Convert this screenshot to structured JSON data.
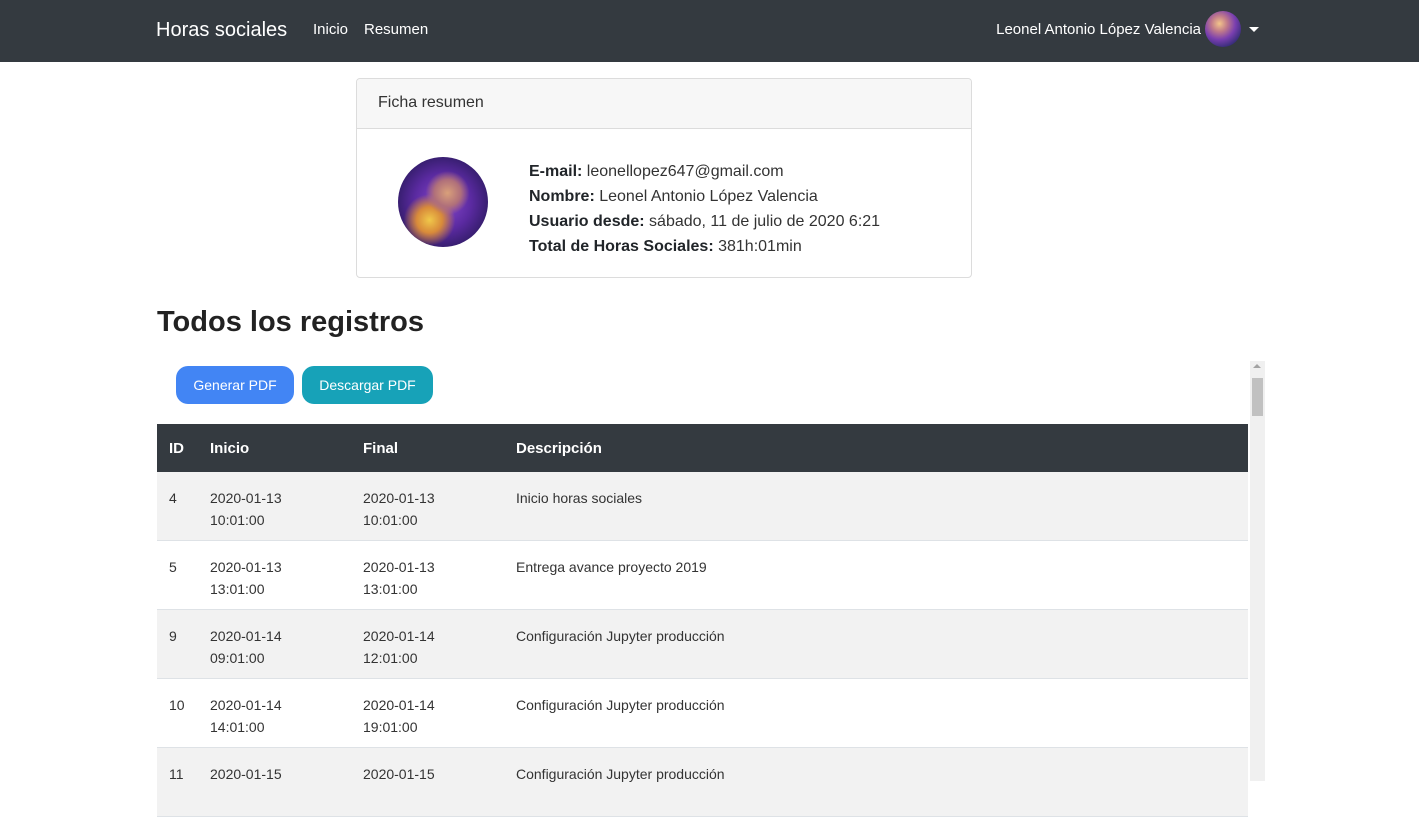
{
  "navbar": {
    "brand": "Horas sociales",
    "links": [
      "Inicio",
      "Resumen"
    ],
    "user_name": "Leonel Antonio López Valencia"
  },
  "card": {
    "header": "Ficha resumen",
    "email_label": "E-mail:",
    "email": "leonellopez647@gmail.com",
    "name_label": "Nombre:",
    "name": "Leonel Antonio López Valencia",
    "since_label": "Usuario desde:",
    "since": "sábado, 11 de julio de 2020 6:21",
    "total_label": "Total de Horas Sociales:",
    "total": "381h:01min"
  },
  "heading": "Todos los registros",
  "buttons": {
    "generate": "Generar PDF",
    "download": "Descargar PDF"
  },
  "table": {
    "headers": [
      "ID",
      "Inicio",
      "Final",
      "Descripción"
    ],
    "rows": [
      {
        "id": "4",
        "inicio_date": "2020-01-13",
        "inicio_time": "10:01:00",
        "final_date": "2020-01-13",
        "final_time": "10:01:00",
        "desc": "Inicio horas sociales"
      },
      {
        "id": "5",
        "inicio_date": "2020-01-13",
        "inicio_time": "13:01:00",
        "final_date": "2020-01-13",
        "final_time": "13:01:00",
        "desc": "Entrega avance proyecto 2019"
      },
      {
        "id": "9",
        "inicio_date": "2020-01-14",
        "inicio_time": "09:01:00",
        "final_date": "2020-01-14",
        "final_time": "12:01:00",
        "desc": "Configuración Jupyter producción"
      },
      {
        "id": "10",
        "inicio_date": "2020-01-14",
        "inicio_time": "14:01:00",
        "final_date": "2020-01-14",
        "final_time": "19:01:00",
        "desc": "Configuración Jupyter producción"
      },
      {
        "id": "11",
        "inicio_date": "2020-01-15",
        "inicio_time": "",
        "final_date": "2020-01-15",
        "final_time": "",
        "desc": "Configuración Jupyter producción"
      }
    ]
  },
  "colors": {
    "navbar": "#343a40",
    "generate_button": "#4285f4",
    "download_button": "#17a2b8"
  }
}
